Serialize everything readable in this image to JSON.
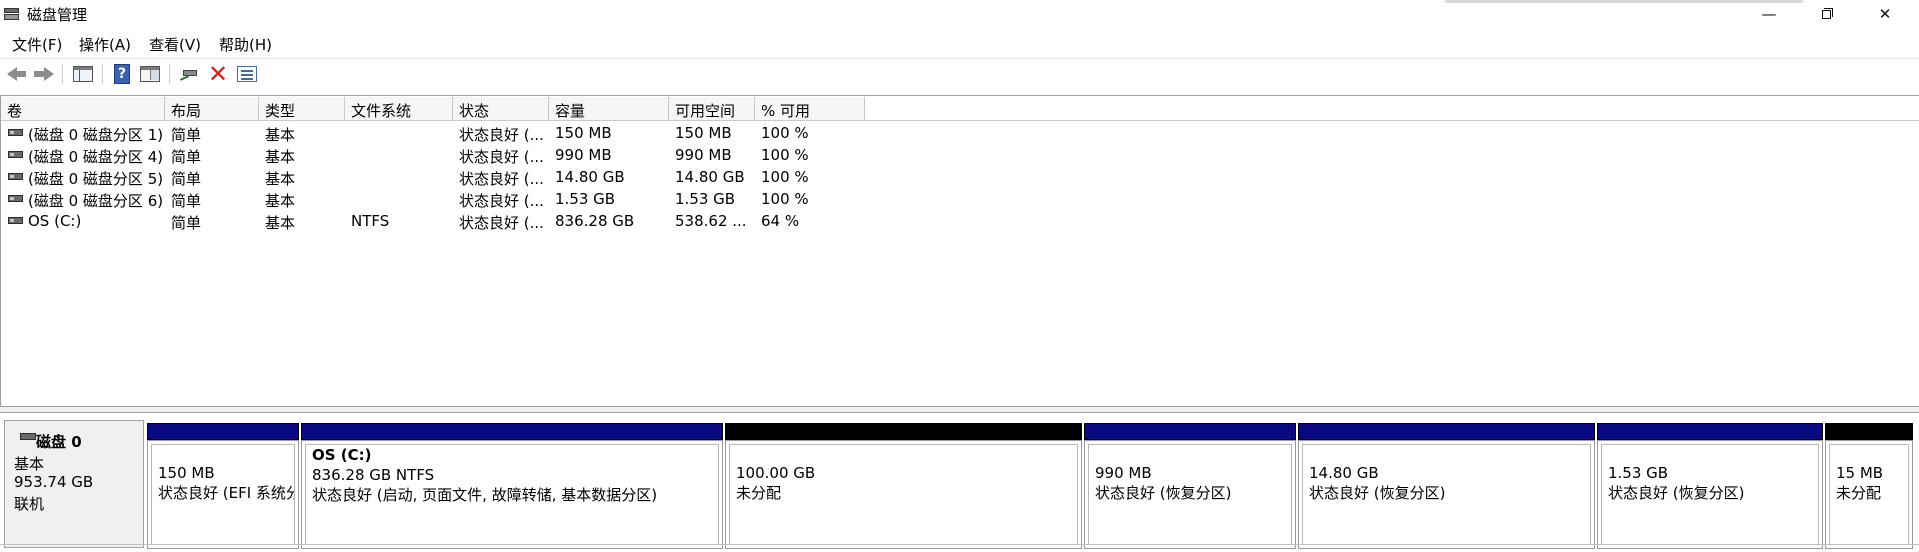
{
  "window": {
    "title": "磁盘管理",
    "minimize_label": "—",
    "close_label": "✕"
  },
  "menu": {
    "items": [
      "文件(F)",
      "操作(A)",
      "查看(V)",
      "帮助(H)"
    ]
  },
  "toolbar": {
    "buttons": [
      "back-icon",
      "forward-icon",
      "show-hide-console-tree-icon",
      "help-icon",
      "properties-icon",
      "connect-icon",
      "delete-icon",
      "list-view-icon"
    ],
    "help_glyph": "?",
    "delete_glyph": "✕"
  },
  "volume_list": {
    "columns": [
      "卷",
      "布局",
      "类型",
      "文件系统",
      "状态",
      "容量",
      "可用空间",
      "% 可用"
    ],
    "rows": [
      {
        "volume": "(磁盘 0 磁盘分区 1)",
        "layout": "简单",
        "type": "基本",
        "fs": "",
        "status": "状态良好 (...",
        "capacity": "150 MB",
        "free": "150 MB",
        "pct": "100 %"
      },
      {
        "volume": "(磁盘 0 磁盘分区 4)",
        "layout": "简单",
        "type": "基本",
        "fs": "",
        "status": "状态良好 (...",
        "capacity": "990 MB",
        "free": "990 MB",
        "pct": "100 %"
      },
      {
        "volume": "(磁盘 0 磁盘分区 5)",
        "layout": "简单",
        "type": "基本",
        "fs": "",
        "status": "状态良好 (...",
        "capacity": "14.80 GB",
        "free": "14.80 GB",
        "pct": "100 %"
      },
      {
        "volume": "(磁盘 0 磁盘分区 6)",
        "layout": "简单",
        "type": "基本",
        "fs": "",
        "status": "状态良好 (...",
        "capacity": "1.53 GB",
        "free": "1.53 GB",
        "pct": "100 %"
      },
      {
        "volume": "OS (C:)",
        "layout": "简单",
        "type": "基本",
        "fs": "NTFS",
        "status": "状态良好 (...",
        "capacity": "836.28 GB",
        "free": "538.62 ...",
        "pct": "64 %"
      }
    ]
  },
  "disk": {
    "name": "磁盘 0",
    "type": "基本",
    "size": "953.74 GB",
    "state": "联机"
  },
  "partitions": [
    {
      "title": "",
      "size": "150 MB",
      "status": "状态良好 (EFI 系统分",
      "bar_color": "#0a0a80"
    },
    {
      "title": "OS  (C:)",
      "size": "836.28 GB NTFS",
      "status": "状态良好 (启动, 页面文件, 故障转储, 基本数据分区)",
      "bar_color": "#0a0a80"
    },
    {
      "title": "",
      "size": "100.00 GB",
      "status": "未分配",
      "bar_color": "#000000"
    },
    {
      "title": "",
      "size": "990 MB",
      "status": "状态良好 (恢复分区)",
      "bar_color": "#0a0a80"
    },
    {
      "title": "",
      "size": "14.80 GB",
      "status": "状态良好 (恢复分区)",
      "bar_color": "#0a0a80"
    },
    {
      "title": "",
      "size": "1.53 GB",
      "status": "状态良好 (恢复分区)",
      "bar_color": "#0a0a80"
    },
    {
      "title": "",
      "size": "15 MB",
      "status": "未分配",
      "bar_color": "#000000"
    }
  ]
}
